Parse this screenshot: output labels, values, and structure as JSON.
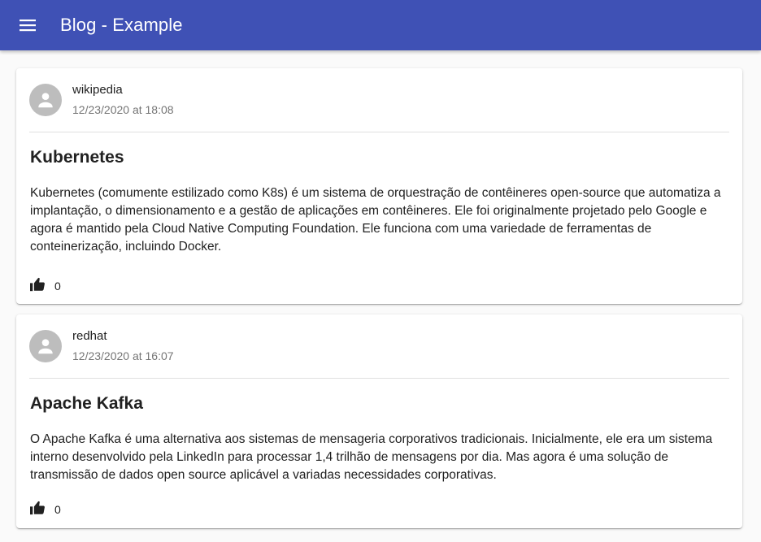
{
  "app": {
    "title": "Blog - Example",
    "menu_icon": "menu-icon",
    "colors": {
      "appbar": "#3f51b5",
      "background": "#fafafa",
      "card": "#ffffff"
    }
  },
  "posts": [
    {
      "author": "wikipedia",
      "date": "12/23/2020 at 18:08",
      "title": "Kubernetes",
      "body": "Kubernetes (comumente estilizado como K8s) é um sistema de orquestração de contêineres open-source que automatiza a implantação, o dimensionamento e a gestão de aplicações em contêineres. Ele foi originalmente projetado pelo Google e agora é mantido pela Cloud Native Computing Foundation. Ele funciona com uma variedade de ferramentas de conteinerização, incluindo Docker.",
      "likes": "0",
      "avatar_icon": "person-icon",
      "like_icon": "thumb-up-icon"
    },
    {
      "author": "redhat",
      "date": "12/23/2020 at 16:07",
      "title": "Apache Kafka",
      "body": "O Apache Kafka é uma alternativa aos sistemas de mensageria corporativos tradicionais. Inicialmente, ele era um sistema interno desenvolvido pela LinkedIn para processar 1,4 trilhão de mensagens por dia. Mas agora é uma solução de transmissão de dados open source aplicável a variadas necessidades corporativas.",
      "likes": "0",
      "avatar_icon": "person-icon",
      "like_icon": "thumb-up-icon"
    }
  ]
}
